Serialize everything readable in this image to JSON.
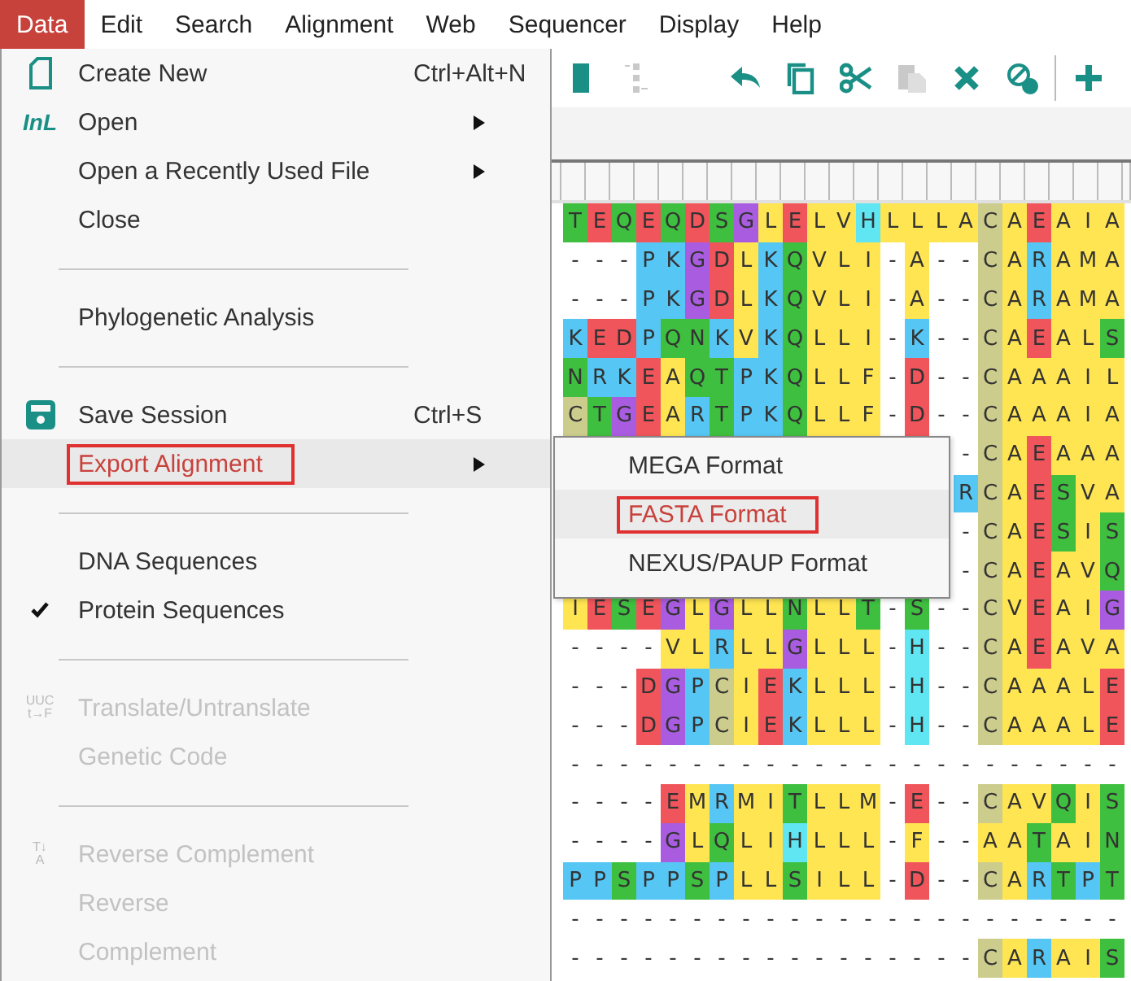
{
  "menubar": [
    {
      "label": "Data",
      "selected": true
    },
    {
      "label": "Edit",
      "selected": false
    },
    {
      "label": "Search",
      "selected": false
    },
    {
      "label": "Alignment",
      "selected": false
    },
    {
      "label": "Web",
      "selected": false
    },
    {
      "label": "Sequencer",
      "selected": false
    },
    {
      "label": "Display",
      "selected": false
    },
    {
      "label": "Help",
      "selected": false
    }
  ],
  "toolbar": [
    {
      "kind": "block",
      "disabled": false
    },
    {
      "kind": "insert",
      "disabled": true
    },
    {
      "kind": "undo",
      "disabled": false
    },
    {
      "kind": "copy",
      "disabled": false
    },
    {
      "kind": "cut",
      "disabled": false
    },
    {
      "kind": "paste",
      "disabled": true
    },
    {
      "kind": "delete",
      "disabled": false
    },
    {
      "kind": "no-gaps",
      "disabled": false
    },
    {
      "kind": "add",
      "disabled": false
    }
  ],
  "alignment": {
    "rows": [
      {
        "residues": "T E Q E Q D S G L E L V H L L L A C A E A I A"
      },
      {
        "residues": "- - - P K G D L K Q V L I - A - - C A R A M A"
      },
      {
        "residues": "- - - P K G D L K Q V L I - A - - C A R A M A"
      },
      {
        "residues": "K E D P Q N K V K Q L L I - K - - C A E A L S"
      },
      {
        "residues": "N R K E A Q T P K Q L L F - D - - C A A A I L"
      },
      {
        "residues": "C T G E A R T P K Q L L F - D - - C A A A I A"
      },
      {
        "residues": "- C A E A A A"
      },
      {
        "residues": "R C A E S V A"
      },
      {
        "residues": "- C A E S I S"
      },
      {
        "residues": "- C A E A V Q"
      },
      {
        "residues": "I E S E G L G L L N L L T - S - - C V E A I G"
      },
      {
        "residues": "- - - - V L R L L G L L L - H - - C A E A V A"
      },
      {
        "residues": "- - - D G P C I E K L L L - H - - C A A A L E"
      },
      {
        "residues": "- - - D G P C I E K L L L - H - - C A A A L E"
      },
      {
        "residues": "- - - - - - - - - - - - - - - - - - - - - - -"
      },
      {
        "residues": "- - - - E M R M I T L L M - E - - C A V Q I S"
      },
      {
        "residues": "- - - - G L Q L I H L L L - F - - A A T A I N"
      },
      {
        "residues": "P P S P P S P L L S I L L - D - - C A R T P T"
      },
      {
        "residues": "- - - - - - - - - - - - - - - - - - - - - - -"
      },
      {
        "residues": "- - - - - - - - - - - - - - - - - C A R A I S"
      }
    ]
  },
  "data_menu": {
    "items": [
      {
        "kind": "item",
        "label": "Create New",
        "shortcut": "Ctrl+Alt+N",
        "icon": {
          "kind": "document"
        },
        "disabled": false,
        "checked": false,
        "selected": false,
        "submenu": false,
        "marked": false
      },
      {
        "kind": "item",
        "label": "Open",
        "icon": {
          "kind": "text",
          "lines": [
            "InL"
          ]
        },
        "disabled": false,
        "checked": false,
        "selected": false,
        "submenu": true,
        "marked": false
      },
      {
        "kind": "item",
        "label": "Open a Recently Used File",
        "disabled": false,
        "checked": false,
        "selected": false,
        "submenu": true,
        "marked": false
      },
      {
        "kind": "item",
        "label": "Close",
        "disabled": false,
        "checked": false,
        "selected": false,
        "submenu": false,
        "marked": false
      },
      {
        "kind": "separator"
      },
      {
        "kind": "item",
        "label": "Phylogenetic Analysis",
        "disabled": false,
        "checked": false,
        "selected": false,
        "submenu": false,
        "marked": false
      },
      {
        "kind": "separator"
      },
      {
        "kind": "item",
        "label": "Save Session",
        "shortcut": "Ctrl+S",
        "icon": {
          "kind": "save"
        },
        "disabled": false,
        "checked": false,
        "selected": false,
        "submenu": false,
        "marked": false
      },
      {
        "kind": "item",
        "label": "Export Alignment",
        "disabled": false,
        "checked": false,
        "selected": true,
        "submenu": true,
        "marked": true
      },
      {
        "kind": "separator"
      },
      {
        "kind": "item",
        "label": "DNA Sequences",
        "disabled": false,
        "checked": false,
        "selected": false,
        "submenu": false,
        "marked": false
      },
      {
        "kind": "item",
        "label": "Protein Sequences",
        "disabled": false,
        "checked": true,
        "selected": false,
        "submenu": false,
        "marked": false
      },
      {
        "kind": "separator"
      },
      {
        "kind": "item",
        "label": "Translate/Untranslate",
        "icon": {
          "kind": "text",
          "lines": [
            "UUC",
            "t→F"
          ]
        },
        "disabled": true,
        "checked": false,
        "selected": false,
        "submenu": false,
        "marked": false
      },
      {
        "kind": "item",
        "label": "Genetic Code",
        "disabled": true,
        "checked": false,
        "selected": false,
        "submenu": false,
        "marked": false
      },
      {
        "kind": "separator"
      },
      {
        "kind": "item",
        "label": "Reverse Complement",
        "icon": {
          "kind": "text",
          "lines": [
            "T↓",
            "A"
          ]
        },
        "disabled": true,
        "checked": false,
        "selected": false,
        "submenu": false,
        "marked": false
      },
      {
        "kind": "item",
        "label": "Reverse",
        "disabled": true,
        "checked": false,
        "selected": false,
        "submenu": false,
        "marked": false
      },
      {
        "kind": "item",
        "label": "Complement",
        "disabled": true,
        "checked": false,
        "selected": false,
        "submenu": false,
        "marked": false
      }
    ]
  },
  "export_submenu": {
    "items": [
      {
        "label": "MEGA Format",
        "selected": false,
        "marked": false
      },
      {
        "label": "FASTA Format",
        "selected": true,
        "marked": true
      },
      {
        "label": "NEXUS/PAUP Format",
        "selected": false,
        "marked": false
      }
    ]
  }
}
